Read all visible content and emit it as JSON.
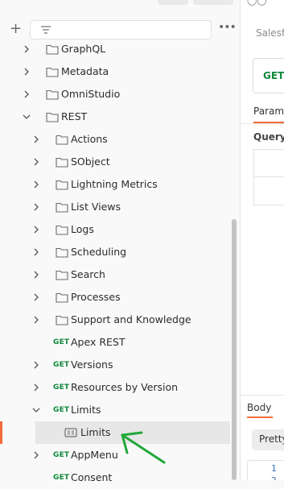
{
  "sidebar": {
    "toolbar": {
      "add_icon": "plus-icon",
      "filter_icon": "filter-icon",
      "more_label": "•••"
    },
    "tree": [
      {
        "label": "GraphQL",
        "type": "folder",
        "depth": 1,
        "chevron": "right"
      },
      {
        "label": "Metadata",
        "type": "folder",
        "depth": 1,
        "chevron": "right"
      },
      {
        "label": "OmniStudio",
        "type": "folder",
        "depth": 1,
        "chevron": "right"
      },
      {
        "label": "REST",
        "type": "folder",
        "depth": 1,
        "chevron": "down"
      },
      {
        "label": "Actions",
        "type": "folder",
        "depth": 2,
        "chevron": "right"
      },
      {
        "label": "SObject",
        "type": "folder",
        "depth": 2,
        "chevron": "right"
      },
      {
        "label": "Lightning Metrics",
        "type": "folder",
        "depth": 2,
        "chevron": "right"
      },
      {
        "label": "List Views",
        "type": "folder",
        "depth": 2,
        "chevron": "right"
      },
      {
        "label": "Logs",
        "type": "folder",
        "depth": 2,
        "chevron": "right"
      },
      {
        "label": "Scheduling",
        "type": "folder",
        "depth": 2,
        "chevron": "right"
      },
      {
        "label": "Search",
        "type": "folder",
        "depth": 2,
        "chevron": "right"
      },
      {
        "label": "Processes",
        "type": "folder",
        "depth": 2,
        "chevron": "right"
      },
      {
        "label": "Support and Knowledge",
        "type": "folder",
        "depth": 2,
        "chevron": "right"
      },
      {
        "label": "Apex REST",
        "type": "request",
        "method": "GET",
        "depth": 2,
        "chevron": "none"
      },
      {
        "label": "Versions",
        "type": "request",
        "method": "GET",
        "depth": 2,
        "chevron": "right"
      },
      {
        "label": "Resources by Version",
        "type": "request",
        "method": "GET",
        "depth": 2,
        "chevron": "right"
      },
      {
        "label": "Limits",
        "type": "request",
        "method": "GET",
        "depth": 2,
        "chevron": "down"
      },
      {
        "label": "Limits",
        "type": "example",
        "depth": 3,
        "chevron": "none",
        "selected": true
      },
      {
        "label": "AppMenu",
        "type": "request",
        "method": "GET",
        "depth": 2,
        "chevron": "right"
      },
      {
        "label": "Consent",
        "type": "request",
        "method": "GET",
        "depth": 2,
        "chevron": "none"
      }
    ]
  },
  "request_pane": {
    "tab_label": "Salesf",
    "method": "GET",
    "params_tab": "Params",
    "query_heading": "Query",
    "body_tab": "Body",
    "pretty_button": "Pretty",
    "line_numbers": [
      "1",
      "2"
    ]
  },
  "colors": {
    "accent": "#f26b3a",
    "get_method": "#0f8a3c",
    "annotation_arrow": "#22a83a",
    "selected_row": "#e7e7e7"
  }
}
